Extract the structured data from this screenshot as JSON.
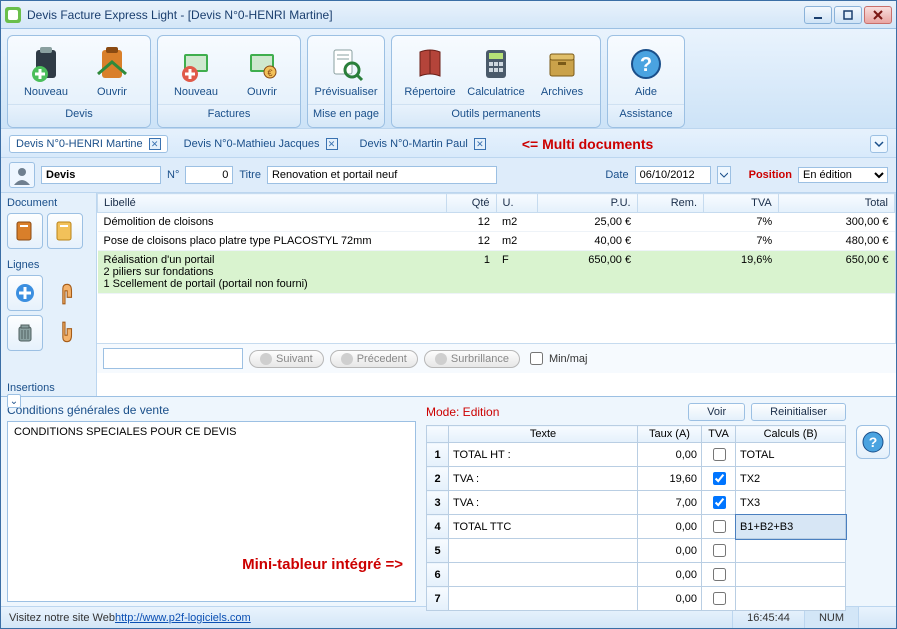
{
  "window": {
    "title": "Devis Facture Express Light - [Devis N°0-HENRI Martine]"
  },
  "ribbon": {
    "groups": [
      {
        "label": "Devis",
        "buttons": [
          {
            "label": "Nouveau",
            "icon": "clipboard-new"
          },
          {
            "label": "Ouvrir",
            "icon": "clipboard-open"
          }
        ]
      },
      {
        "label": "Factures",
        "buttons": [
          {
            "label": "Nouveau",
            "icon": "invoice-new"
          },
          {
            "label": "Ouvrir",
            "icon": "invoice-open"
          }
        ]
      },
      {
        "label": "Mise en page",
        "buttons": [
          {
            "label": "Prévisualiser",
            "icon": "preview"
          }
        ]
      },
      {
        "label": "Outils permanents",
        "buttons": [
          {
            "label": "Répertoire",
            "icon": "directory"
          },
          {
            "label": "Calculatrice",
            "icon": "calculator"
          },
          {
            "label": "Archives",
            "icon": "archives"
          }
        ]
      },
      {
        "label": "Assistance",
        "buttons": [
          {
            "label": "Aide",
            "icon": "help"
          }
        ]
      }
    ]
  },
  "tabs": {
    "items": [
      {
        "label": "Devis N°0-HENRI Martine",
        "active": true
      },
      {
        "label": "Devis N°0-Mathieu Jacques",
        "active": false
      },
      {
        "label": "Devis N°0-Martin Paul",
        "active": false
      }
    ],
    "callout": "<= Multi documents"
  },
  "doc_header": {
    "type": "Devis",
    "num_label": "N°",
    "num_value": "0",
    "titre_label": "Titre",
    "titre_value": "Renovation et portail neuf",
    "date_label": "Date",
    "date_value": "06/10/2012",
    "position_label": "Position",
    "position_value": "En édition"
  },
  "left_panel": {
    "sections": [
      "Document",
      "Lignes",
      "Insertions"
    ]
  },
  "lines": {
    "headers": {
      "libelle": "Libellé",
      "qte": "Qté",
      "u": "U.",
      "pu": "P.U.",
      "rem": "Rem.",
      "tva": "TVA",
      "total": "Total"
    },
    "rows": [
      {
        "libelle": "Démolition de cloisons",
        "qte": "12",
        "u": "m2",
        "pu": "25,00 €",
        "rem": "",
        "tva": "7%",
        "total": "300,00 €",
        "sel": false
      },
      {
        "libelle": "Pose de cloisons placo platre type PLACOSTYL 72mm",
        "qte": "12",
        "u": "m2",
        "pu": "40,00 €",
        "rem": "",
        "tva": "7%",
        "total": "480,00 €",
        "sel": false
      },
      {
        "libelle": "Réalisation d'un portail\n2 piliers sur fondations\n1 Scellement de portail (portail non fourni)",
        "qte": "1",
        "u": "F",
        "pu": "650,00 €",
        "rem": "",
        "tva": "19,6%",
        "total": "650,00 €",
        "sel": true
      }
    ],
    "search": {
      "placeholder": "",
      "suivant": "Suivant",
      "precedent": "Précedent",
      "surbrillance": "Surbrillance",
      "minmaj": "Min/maj"
    }
  },
  "cgv": {
    "title": "Conditions générales de vente",
    "body": "CONDITIONS SPECIALES POUR CE DEVIS",
    "callout": "Mini-tableur intégré =>"
  },
  "mini": {
    "mode": "Mode: Edition",
    "btn_voir": "Voir",
    "btn_reset": "Reinitialiser",
    "headers": {
      "texte": "Texte",
      "taux": "Taux (A)",
      "tva": "TVA",
      "calculs": "Calculs (B)"
    },
    "rows": [
      {
        "n": "1",
        "texte": "TOTAL HT :",
        "taux": "0,00",
        "tva": false,
        "calc": "TOTAL"
      },
      {
        "n": "2",
        "texte": "TVA :",
        "taux": "19,60",
        "tva": true,
        "calc": "TX2"
      },
      {
        "n": "3",
        "texte": "TVA :",
        "taux": "7,00",
        "tva": true,
        "calc": "TX3"
      },
      {
        "n": "4",
        "texte": "TOTAL TTC",
        "taux": "0,00",
        "tva": false,
        "calc": "B1+B2+B3"
      },
      {
        "n": "5",
        "texte": "",
        "taux": "0,00",
        "tva": false,
        "calc": ""
      },
      {
        "n": "6",
        "texte": "",
        "taux": "0,00",
        "tva": false,
        "calc": ""
      },
      {
        "n": "7",
        "texte": "",
        "taux": "0,00",
        "tva": false,
        "calc": ""
      }
    ]
  },
  "status": {
    "prefix": "Visitez notre site Web ",
    "link": "http://www.p2f-logiciels.com",
    "time": "16:45:44",
    "num": "NUM"
  }
}
